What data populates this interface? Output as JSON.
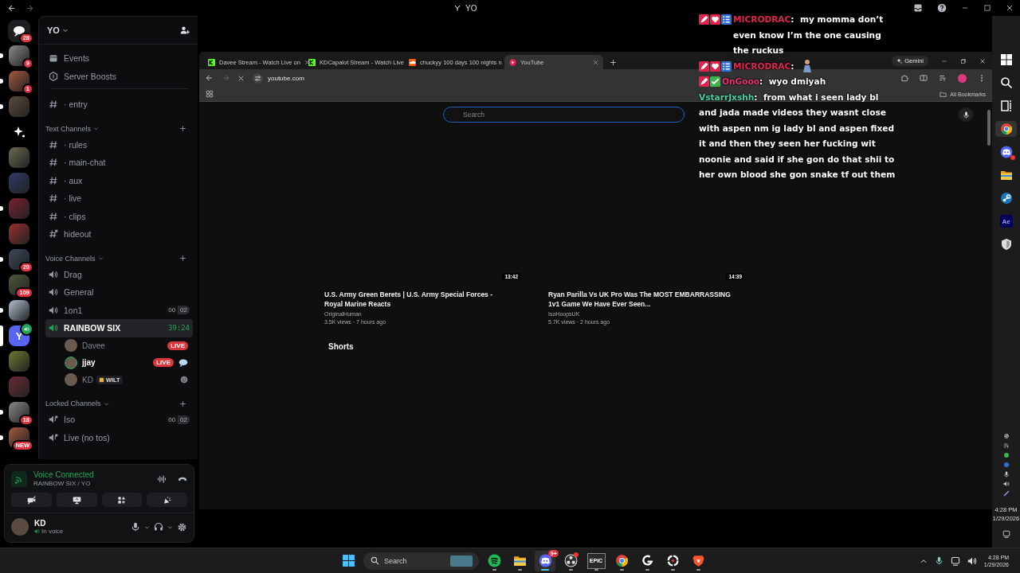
{
  "title_bar": {
    "title": "YO"
  },
  "servers": [
    {
      "kind": "home",
      "badge": "28",
      "unread": false,
      "selected": false,
      "in_voice": false
    },
    {
      "kind": "avatar",
      "badge": "9",
      "unread": true,
      "selected": false,
      "in_voice": false
    },
    {
      "kind": "avatar",
      "badge": "1",
      "unread": true,
      "selected": false,
      "in_voice": false
    },
    {
      "kind": "avatar",
      "unread": true,
      "selected": false,
      "in_voice": false
    },
    {
      "kind": "discover",
      "unread": false,
      "selected": false,
      "in_voice": false
    },
    {
      "kind": "avatar",
      "unread": false,
      "selected": false,
      "in_voice": false
    },
    {
      "kind": "avatar",
      "unread": false,
      "selected": false,
      "in_voice": false
    },
    {
      "kind": "avatar",
      "unread": true,
      "selected": false,
      "in_voice": false
    },
    {
      "kind": "avatar",
      "unread": false,
      "selected": false,
      "in_voice": false
    },
    {
      "kind": "avatar",
      "badge": "20",
      "unread": true,
      "selected": false,
      "in_voice": false
    },
    {
      "kind": "avatar",
      "badge": "109",
      "unread": false,
      "selected": false,
      "in_voice": false
    },
    {
      "kind": "avatar",
      "unread": true,
      "selected": false,
      "in_voice": false
    },
    {
      "kind": "letter",
      "label": "Y",
      "unread": false,
      "selected": true,
      "in_voice": true
    },
    {
      "kind": "avatar",
      "unread": false,
      "selected": false,
      "in_voice": false
    },
    {
      "kind": "avatar",
      "unread": false,
      "selected": false,
      "in_voice": false
    },
    {
      "kind": "avatar",
      "badge": "18",
      "unread": true,
      "selected": false,
      "in_voice": false
    },
    {
      "kind": "avatar",
      "badge": "NEW",
      "unread": true,
      "selected": false,
      "in_voice": false
    }
  ],
  "sidebar": {
    "server_name": "YO",
    "links": [
      {
        "kind": "events",
        "label": "Events"
      },
      {
        "kind": "boosts",
        "label": "Server Boosts"
      }
    ],
    "channels": [
      {
        "kind": "text",
        "name": "· entry",
        "selected": false
      }
    ],
    "categories": [
      {
        "name": "Text Channels",
        "channels": [
          {
            "kind": "text",
            "name": "· rules",
            "selected": false
          },
          {
            "kind": "text",
            "name": "· main-chat",
            "selected": false
          },
          {
            "kind": "text",
            "name": "· aux",
            "selected": false
          },
          {
            "kind": "text",
            "name": "· live",
            "selected": false
          },
          {
            "kind": "text",
            "name": "· clips",
            "selected": false
          },
          {
            "kind": "thread",
            "name": "hideout",
            "selected": false
          }
        ]
      },
      {
        "name": "Voice Channels",
        "channels": [
          {
            "kind": "voice",
            "name": "Drag",
            "selected": false
          },
          {
            "kind": "voice",
            "name": "General",
            "selected": false
          },
          {
            "kind": "voice",
            "name": "1on1",
            "selected": false,
            "limit": {
              "current": "00",
              "max": "02"
            }
          },
          {
            "kind": "voice",
            "name": "RAINBOW SIX",
            "selected": true,
            "timer": "39:24",
            "users": [
              {
                "name": "Davee",
                "badge": "LIVE",
                "speaking": false
              },
              {
                "name": "jjay",
                "badge": "LIVE",
                "speaking": true,
                "status_icon": {
                  "kind": "chat"
                }
              },
              {
                "name": "KD",
                "tag": "WILT",
                "speaking": false,
                "status_icon": {
                  "kind": "emoji"
                }
              }
            ]
          }
        ]
      },
      {
        "name": "Locked Channels",
        "channels": [
          {
            "kind": "locked",
            "name": "Iso",
            "selected": false,
            "limit": {
              "current": "00",
              "max": "02"
            }
          },
          {
            "kind": "locked",
            "name": "Live (no tos)",
            "selected": false
          }
        ]
      }
    ]
  },
  "voice_panel": {
    "status": "Voice Connected",
    "location": "RAINBOW SIX / YO"
  },
  "user_panel": {
    "name": "KD",
    "status": "In voice"
  },
  "browser": {
    "tabs": [
      {
        "kind": "kick",
        "title": "Davee Stream - Watch Live on",
        "selected": false
      },
      {
        "kind": "kick",
        "title": "KDCapalot Stream - Watch Live",
        "selected": false
      },
      {
        "kind": "soundcloud",
        "title": "chuckyy 100 days 100 nights n",
        "selected": false
      },
      {
        "kind": "youtube",
        "title": "YouTube",
        "selected": true
      }
    ],
    "gemini": "Gemini",
    "url": "youtube.com",
    "bookmarks": "All Bookmarks",
    "page": {
      "search_placeholder": "Search",
      "videos": [
        {
          "duration": "13:42",
          "title": "U.S. Army Green Berets | U.S. Army Special Forces - Royal Marine Reacts",
          "channel": "OriginalHuman",
          "meta": "3.5K views · 7 hours ago"
        },
        {
          "duration": "14:39",
          "title": "Ryan Parilla Vs UK Pro Was The MOST EMBARRASSING 1v1 Game We Have Ever Seen...",
          "channel": "IsoHoopsUK",
          "meta": "5.7K views · 2 hours ago"
        }
      ],
      "section": "Shorts"
    }
  },
  "chat": [
    {
      "kind": "text",
      "badges": [
        {
          "kind": "pencil"
        },
        {
          "kind": "heart"
        },
        {
          "kind": "bars"
        }
      ],
      "user": "MICRODRAC",
      "color": "#e3224f",
      "text": ":  my momma don’t even know I’m the one causing the ruckus"
    },
    {
      "kind": "emote",
      "badges": [
        {
          "kind": "pencil"
        },
        {
          "kind": "heart"
        },
        {
          "kind": "bars"
        }
      ],
      "user": "MICRODRAC",
      "color": "#e3224f",
      "text": ":"
    },
    {
      "kind": "text",
      "badges": [
        {
          "kind": "pencil"
        },
        {
          "kind": "check"
        }
      ],
      "user": "OnGooo",
      "color": "#e8336c",
      "text": ":  wyo dmiyah"
    },
    {
      "kind": "text",
      "user": "VstarrJxshh",
      "color": "#4fcf9f",
      "text": ":  from what i seen lady bl and jada made videos they wasnt close with aspen nm ig lady bl and aspen fixed it and then they seen her fucking wit noonie and said if she gon do that shii to her own blood she gon snake tf out them"
    }
  ],
  "side_taskbar": {
    "apps": [
      {
        "kind": "windows",
        "selected": false,
        "alert": false
      },
      {
        "kind": "search",
        "selected": false,
        "alert": false
      },
      {
        "kind": "taskview",
        "selected": false,
        "alert": false
      },
      {
        "kind": "chrome",
        "selected": true,
        "alert": false
      },
      {
        "kind": "discord",
        "selected": false,
        "alert": true
      },
      {
        "kind": "files",
        "selected": false,
        "alert": false
      },
      {
        "kind": "steam",
        "selected": false,
        "alert": false
      },
      {
        "kind": "ae",
        "label": "Ae",
        "selected": false,
        "alert": false
      },
      {
        "kind": "shield",
        "selected": false,
        "alert": false
      }
    ],
    "time": "4:28 PM",
    "date": "1/29/2026"
  },
  "taskbar": {
    "search_placeholder": "Search",
    "apps": [
      {
        "kind": "spotify",
        "selected": false,
        "alert": false
      },
      {
        "kind": "files",
        "selected": false,
        "alert": false
      },
      {
        "kind": "discord",
        "badge": "9+",
        "selected": true,
        "alert": false
      },
      {
        "kind": "obs",
        "selected": false,
        "alert": true
      },
      {
        "kind": "epic",
        "label": "EPIC",
        "selected": false,
        "alert": false
      },
      {
        "kind": "chrome",
        "selected": false,
        "alert": false
      },
      {
        "kind": "logitech",
        "selected": false,
        "alert": false
      },
      {
        "kind": "ring",
        "selected": false,
        "alert": false
      },
      {
        "kind": "brave",
        "selected": false,
        "alert": false
      }
    ],
    "time": "4:28 PM",
    "date": "1/29/2026"
  }
}
